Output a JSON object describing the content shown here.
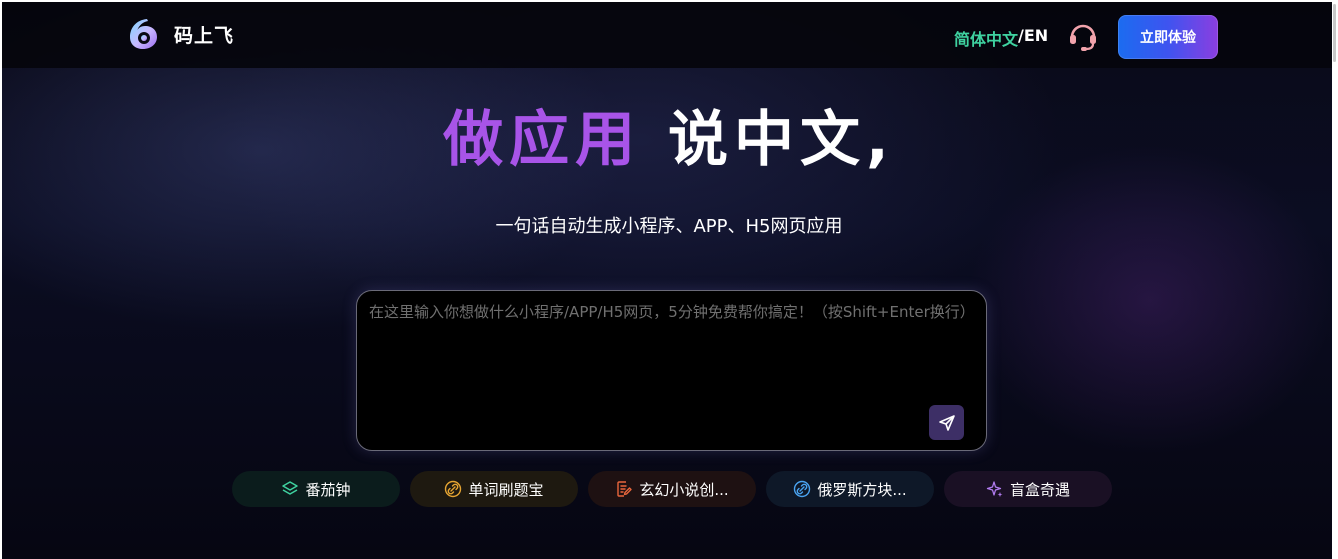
{
  "brand": {
    "name": "码上飞"
  },
  "header": {
    "lang_zh": "简体中文",
    "lang_sep": "/",
    "lang_en": "EN",
    "cta_label": "立即体验"
  },
  "hero": {
    "title_accent": "做应用",
    "title_plain": "说中文,",
    "subtitle": "一句话自动生成小程序、APP、H5网页应用"
  },
  "prompt": {
    "placeholder": "在这里输入你想做什么小程序/APP/H5网页，5分钟免费帮你搞定！（按Shift+Enter换行）",
    "value": ""
  },
  "suggestions": [
    {
      "label": "番茄钟",
      "icon": "layers-icon"
    },
    {
      "label": "单词刷题宝",
      "icon": "link-icon"
    },
    {
      "label": "玄幻小说创...",
      "icon": "edit-document-icon"
    },
    {
      "label": "俄罗斯方块...",
      "icon": "link-icon"
    },
    {
      "label": "盲盒奇遇",
      "icon": "sparkles-icon"
    }
  ],
  "colors": {
    "accent_purple": "#a854e8",
    "lang_active": "#3fd2a0",
    "send_button": "#3d2f66",
    "cta_gradient_start": "#1b6cf0",
    "cta_gradient_end": "#8b3ee0"
  }
}
